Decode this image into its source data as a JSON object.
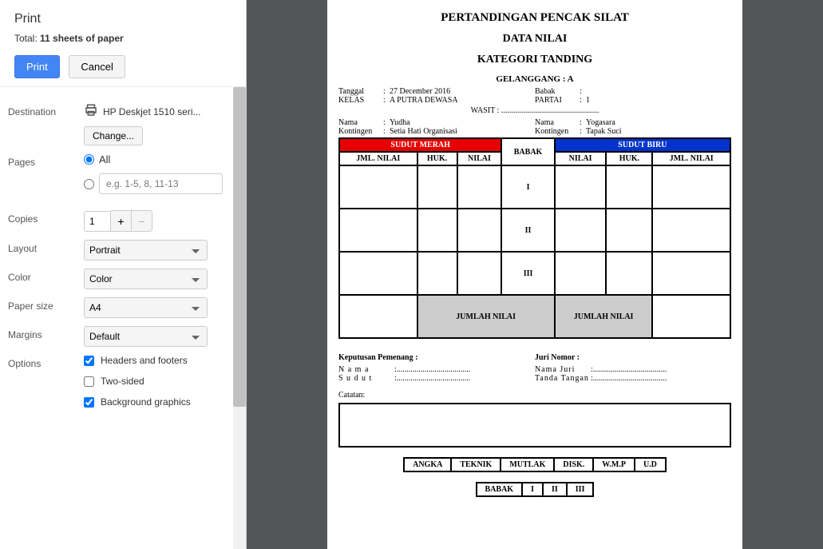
{
  "panel": {
    "title": "Print",
    "total_prefix": "Total: ",
    "total_value": "11 sheets of paper",
    "print_btn": "Print",
    "cancel_btn": "Cancel"
  },
  "destination": {
    "label": "Destination",
    "printer": "HP Deskjet 1510 seri...",
    "change": "Change..."
  },
  "pages": {
    "label": "Pages",
    "all": "All",
    "placeholder": "e.g. 1-5, 8, 11-13"
  },
  "copies": {
    "label": "Copies",
    "value": "1"
  },
  "layout": {
    "label": "Layout",
    "value": "Portrait"
  },
  "color": {
    "label": "Color",
    "value": "Color"
  },
  "paper": {
    "label": "Paper size",
    "value": "A4"
  },
  "margins": {
    "label": "Margins",
    "value": "Default"
  },
  "options": {
    "label": "Options",
    "headers": "Headers and footers",
    "twosided": "Two-sided",
    "bg": "Background graphics"
  },
  "doc": {
    "title1": "PERTANDINGAN PENCAK SILAT",
    "title2": "DATA NILAI",
    "title3": "KATEGORI TANDING",
    "gelanggang": "GELANGGANG : A",
    "tanggal_k": "Tanggal",
    "tanggal_v": "27 December 2016",
    "kelas_k": "KELAS",
    "kelas_v": "A PUTRA DEWASA",
    "babak_k": "Babak",
    "babak_v": "",
    "partai_k": "PARTAI",
    "partai_v": "1",
    "wasit": "WASIT : .................................................",
    "nama1_k": "Nama",
    "nama1_v": "Yudha",
    "kont1_k": "Kontingen",
    "kont1_v": "Setia Hati Organisasi",
    "nama2_k": "Nama",
    "nama2_v": "Yogasara",
    "kont2_k": "Kontingen",
    "kont2_v": "Tapak Suci",
    "sudut_merah": "SUDUT MERAH",
    "sudut_biru": "SUDUT BIRU",
    "babak_hdr": "BABAK",
    "jml_nilai": "JML. NILAI",
    "huk": "HUK.",
    "nilai": "NILAI",
    "r1": "I",
    "r2": "II",
    "r3": "III",
    "jumlah_nilai": "JUMLAH NILAI",
    "kp": "Keputusan Pemenang :",
    "kp_nama": "N a m a",
    "kp_sudut": "S u d u t",
    "jn": "Juri Nomor :",
    "jn_nama": "Nama Juri",
    "jn_tt": "Tanda Tangan",
    "dots": ":.....................................",
    "catatan": "Catatan:",
    "res_angka": "ANGKA",
    "res_teknik": "TEKNIK",
    "res_mutlak": "MUTLAK",
    "res_disk": "DISK.",
    "res_wmp": "W.M.P",
    "res_ud": "U.D",
    "res_babak": "BABAK",
    "res_i": "I",
    "res_ii": "II",
    "res_iii": "III"
  }
}
